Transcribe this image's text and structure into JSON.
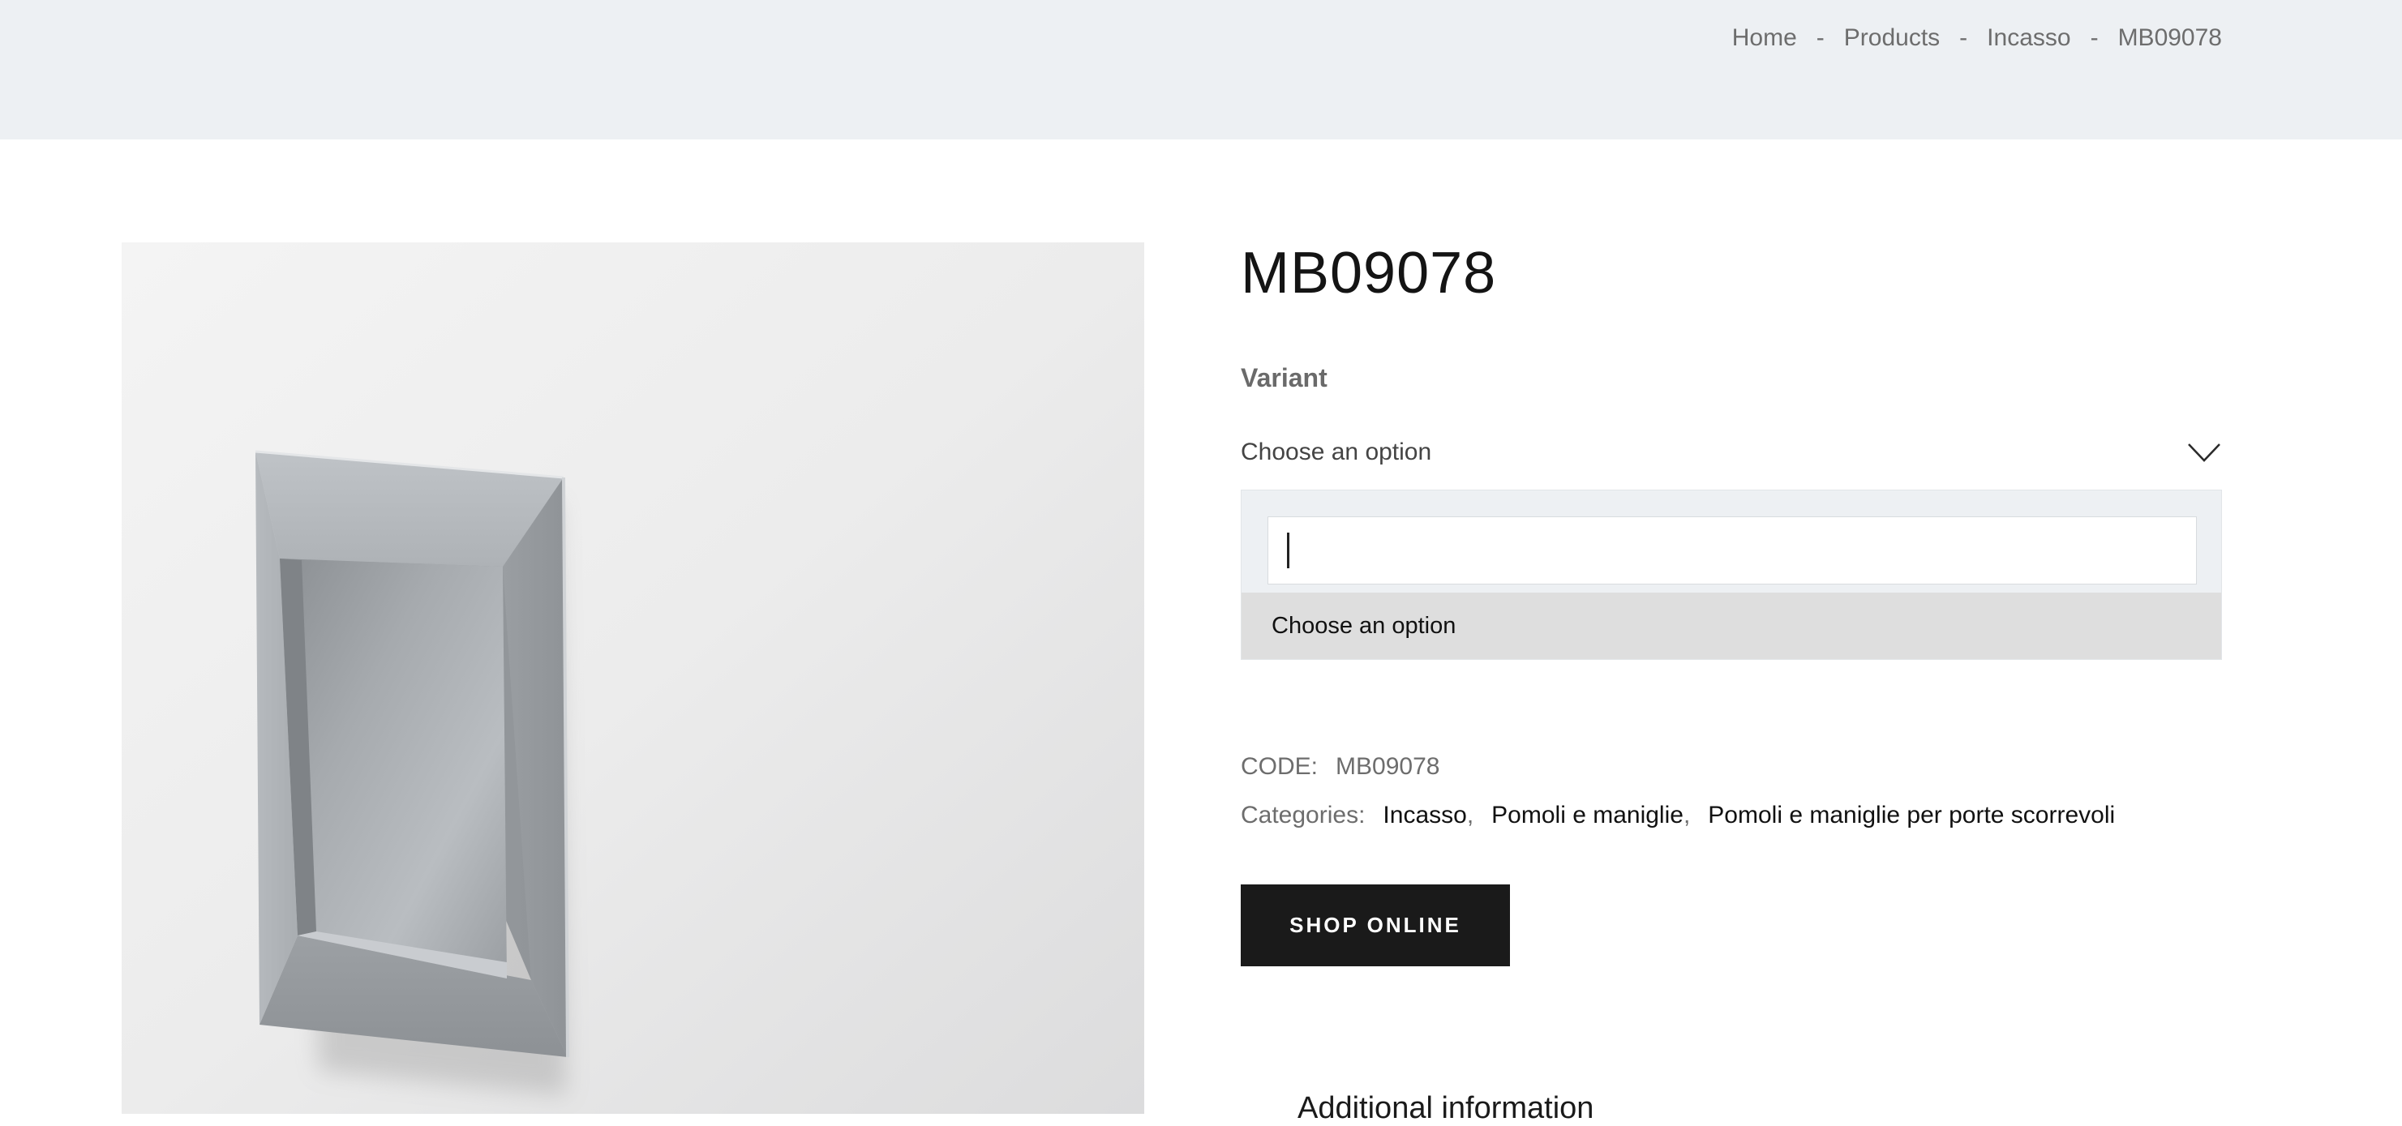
{
  "breadcrumb": {
    "items": [
      "Home",
      "Products",
      "Incasso",
      "MB09078"
    ],
    "separator": "-"
  },
  "product": {
    "title": "MB09078",
    "image_icon": "recessed-flush-pull-handle"
  },
  "variant": {
    "label": "Variant",
    "selected": "Choose an option",
    "search_value": "",
    "options": [
      "Choose an option"
    ]
  },
  "meta": {
    "code_label": "CODE:",
    "code_value": "MB09078",
    "categories_label": "Categories:",
    "categories": [
      "Incasso",
      "Pomoli e maniglie",
      "Pomoli e maniglie per porte scorrevoli"
    ]
  },
  "actions": {
    "shop_label": "SHOP ONLINE"
  },
  "tabs": {
    "additional_info": "Additional information"
  },
  "colors": {
    "topbar_bg": "#edf0f3",
    "button_bg": "#1a1a1a",
    "option_highlight": "#dedede"
  }
}
